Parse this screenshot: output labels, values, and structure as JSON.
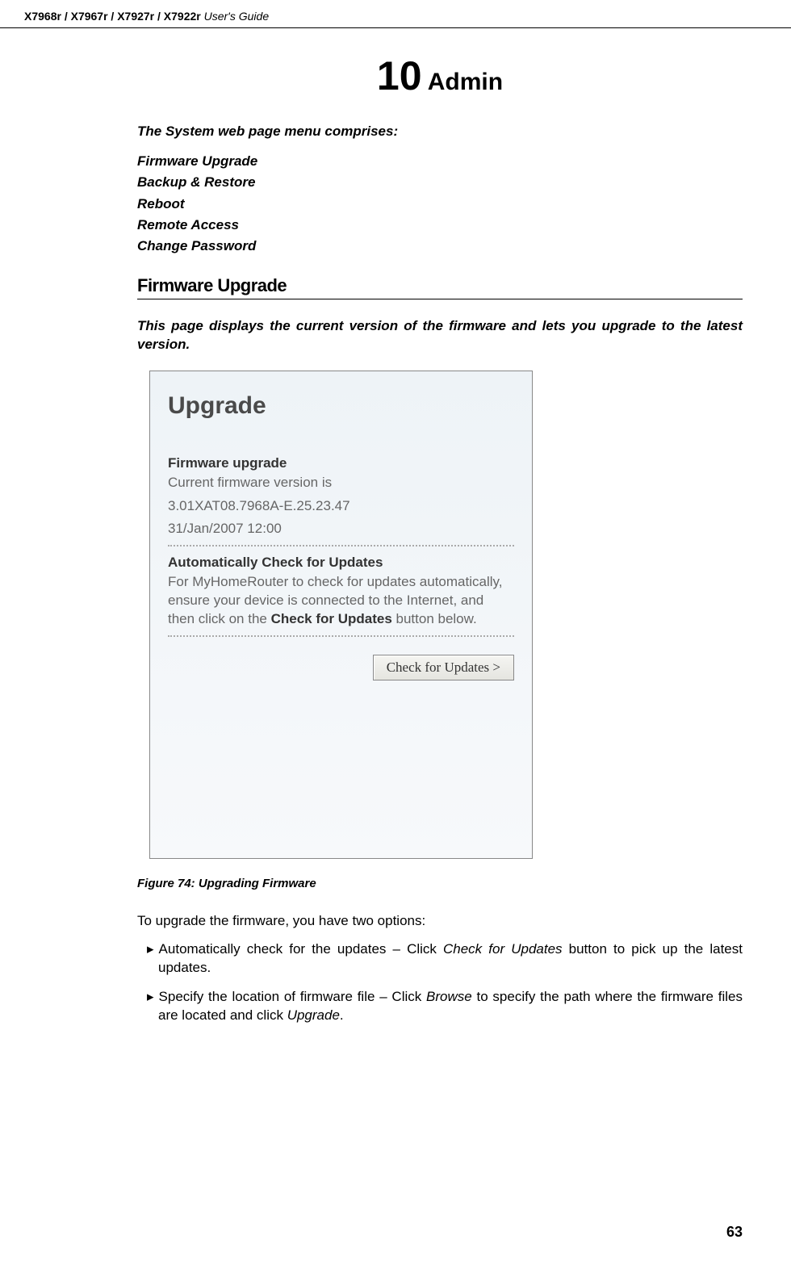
{
  "header": {
    "models": "X7968r / X7967r / X7927r / X7922r",
    "guide": " User's Guide"
  },
  "chapter": {
    "number": "10",
    "name": " Admin"
  },
  "intro": "The System web page menu comprises:",
  "menu_items": [
    "Firmware Upgrade",
    "Backup & Restore",
    "Reboot",
    "Remote Access",
    "Change Password"
  ],
  "section": {
    "heading": "Firmware Upgrade",
    "desc": "This page displays the current version of the firmware and lets you upgrade to the latest version."
  },
  "screenshot": {
    "title": "Upgrade",
    "fw_heading": "Firmware upgrade",
    "fw_line1": "Current firmware version is",
    "fw_line2": "3.01XAT08.7968A-E.25.23.47",
    "fw_line3": "31/Jan/2007 12:00",
    "auto_heading": "Automatically Check for Updates",
    "auto_body_1": "For MyHomeRouter to check for updates automatically, ensure your device is connected to the Internet, and then click on the ",
    "auto_body_bold": "Check for Updates",
    "auto_body_2": " button below.",
    "button_label": "Check for Updates >"
  },
  "figure_caption": "Figure 74: Upgrading Firmware",
  "body_intro": "To upgrade the firmware, you have two options:",
  "bullets": [
    {
      "pre": "Automatically check for the updates – Click ",
      "italic": "Check for Updates",
      "post": " button to pick up the latest updates."
    },
    {
      "pre": "Specify the location of firmware file – Click ",
      "italic": "Browse",
      "mid": " to specify the path where the firmware files are located and click ",
      "italic2": "Upgrade",
      "post": "."
    }
  ],
  "page_number": "63"
}
